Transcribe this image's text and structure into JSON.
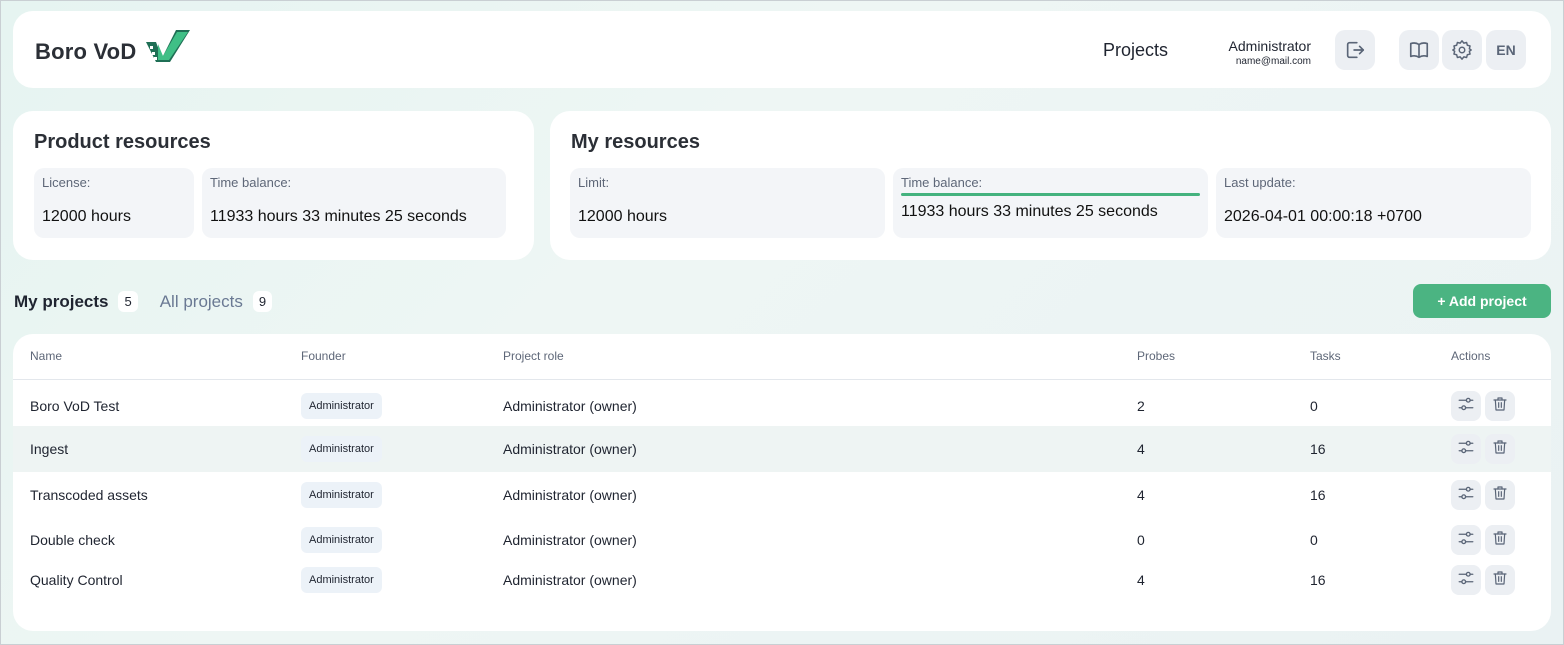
{
  "header": {
    "logo_text": "Boro VoD",
    "nav_projects": "Projects",
    "user_name": "Administrator",
    "user_email": "name@mail.com",
    "lang_label": "EN"
  },
  "product_resources": {
    "title": "Product resources",
    "license_label": "License:",
    "license_value": "12000 hours",
    "balance_label": "Time balance:",
    "balance_value": "11933 hours 33 minutes 25 seconds"
  },
  "my_resources": {
    "title": "My resources",
    "limit_label": "Limit:",
    "limit_value": "12000 hours",
    "balance_label": "Time balance:",
    "balance_value": "11933 hours 33 minutes 25 seconds",
    "update_label": "Last update:",
    "update_value": "2026-04-01 00:00:18 +0700"
  },
  "tabs": {
    "my_label": "My projects",
    "my_count": "5",
    "all_label": "All projects",
    "all_count": "9"
  },
  "add_project_label": "+ Add project",
  "table": {
    "headers": {
      "name": "Name",
      "founder": "Founder",
      "role": "Project role",
      "probes": "Probes",
      "tasks": "Tasks",
      "actions": "Actions"
    },
    "rows": [
      {
        "name": "Boro VoD Test",
        "founder": "Administrator",
        "role": "Administrator (owner)",
        "probes": "2",
        "tasks": "0"
      },
      {
        "name": "Ingest",
        "founder": "Administrator",
        "role": "Administrator (owner)",
        "probes": "4",
        "tasks": "16"
      },
      {
        "name": "Transcoded assets",
        "founder": "Administrator",
        "role": "Administrator (owner)",
        "probes": "4",
        "tasks": "16"
      },
      {
        "name": "Double check",
        "founder": "Administrator",
        "role": "Administrator (owner)",
        "probes": "0",
        "tasks": "0"
      },
      {
        "name": "Quality Control",
        "founder": "Administrator",
        "role": "Administrator (owner)",
        "probes": "4",
        "tasks": "16"
      }
    ]
  },
  "colors": {
    "accent": "#4bb482",
    "balance_bar": "#44b27e",
    "logo_mark": "#1f6f55"
  },
  "icons": {
    "logout": "logout-icon",
    "docs": "book-icon",
    "settings": "gear-icon",
    "edit_row": "sliders-icon",
    "delete_row": "trash-icon"
  }
}
